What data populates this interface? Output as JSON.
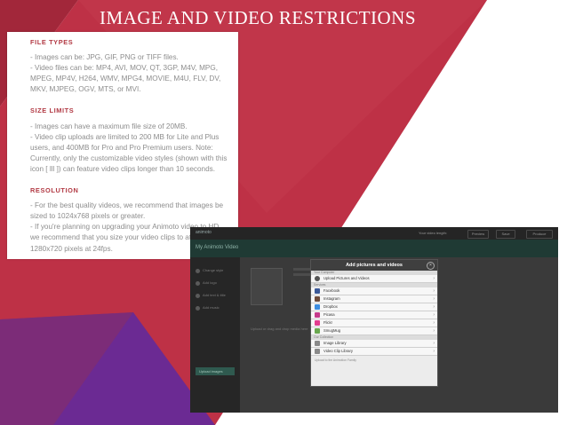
{
  "slide": {
    "title": "IMAGE AND VIDEO RESTRICTIONS",
    "colors": {
      "crimson": "#be3146",
      "crimson_dark": "#a2273a",
      "purple": "#6b2a93",
      "magenta": "#8a2d62",
      "white": "#ffffff"
    }
  },
  "document": {
    "sections": [
      {
        "heading": "FILE TYPES",
        "lines": [
          "- Images can be: JPG, GIF, PNG or TIFF files.",
          "- Video files can be: MP4, AVI, MOV, QT, 3GP, M4V, MPG, MPEG, MP4V, H264, WMV, MPG4, MOVIE, M4U, FLV, DV, MKV, MJPEG, OGV, MTS, or MVI."
        ]
      },
      {
        "heading": "SIZE LIMITS",
        "lines": [
          "- Images can have a maximum file size of 20MB.",
          "- Video clip uploads are limited to 200 MB for Lite and Plus users, and 400MB for Pro and Pro Premium users. Note: Currently, only the customizable video styles (shown with this icon [ lll ]) can feature video clips longer than 10 seconds."
        ]
      },
      {
        "heading": "RESOLUTION",
        "lines": [
          "- For the best quality videos, we recommend that images be sized to 1024x768 pixels or greater.",
          "- If you're planning on upgrading your Animoto video to HD, we recommend that you size your video clips to at least 1280x720 pixels at 24fps."
        ]
      }
    ]
  },
  "screenshot": {
    "app": {
      "brand": "animoto",
      "video_title": "My Animoto Video",
      "top_buttons": [
        "Your video length:",
        "Preview",
        "Save",
        "Produce"
      ],
      "side_items": [
        "Change style",
        "Add logo",
        "Add text & title",
        "Add music"
      ],
      "side_bottom": "Upload images",
      "main_hint": "Upload or drag and drop media here"
    },
    "modal": {
      "title": "Add pictures and videos",
      "close": "×",
      "section_1": "Your Computer",
      "upload_label": "Upload Pictures and Videos",
      "section_2": "Services",
      "services": [
        {
          "name": "Facebook",
          "icon": "facebook-icon",
          "color": "#3b5998"
        },
        {
          "name": "Instagram",
          "icon": "instagram-icon",
          "color": "#6e4b3a"
        },
        {
          "name": "Dropbox",
          "icon": "dropbox-icon",
          "color": "#3d8de0"
        },
        {
          "name": "Picasa",
          "icon": "picasa-icon",
          "color": "#c63b8c"
        },
        {
          "name": "Flickr",
          "icon": "flickr-icon",
          "color": "#e33d8f"
        },
        {
          "name": "SmugMug",
          "icon": "smugmug-icon",
          "color": "#6aa84f"
        }
      ],
      "section_3": "Our Collection",
      "collection": [
        {
          "name": "Image Library",
          "icon": "image-icon",
          "color": "#8a8a8a"
        },
        {
          "name": "Video Clip Library",
          "icon": "video-icon",
          "color": "#8a8a8a"
        }
      ],
      "footer": "Upload to the Animotion Family"
    }
  }
}
